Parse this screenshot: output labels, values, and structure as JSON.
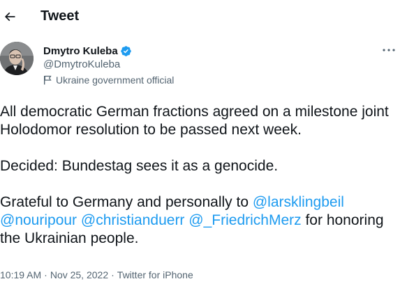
{
  "header": {
    "title": "Tweet",
    "back_icon": "arrow-left-icon"
  },
  "author": {
    "display_name": "Dmytro Kuleba",
    "handle": "@DmytroKuleba",
    "label": "Ukraine government official",
    "verified_icon": "verified-badge-icon",
    "label_icon": "flag-icon",
    "more_icon": "more-horizontal-icon"
  },
  "tweet": {
    "paragraph1": "All democratic German fractions agreed on a milestone joint Holodomor resolution to be passed next week.",
    "paragraph2": "Decided: Bundestag sees it as a genocide.",
    "paragraph3_prefix": "Grateful to Germany and personally to ",
    "mentions": [
      "@larsklingbeil",
      "@nouripour",
      "@christianduerr",
      "@_FriedrichMerz"
    ],
    "paragraph3_suffix": " for honoring the Ukrainian people."
  },
  "meta": {
    "time": "10:19 AM",
    "separator": "·",
    "date": "Nov 25, 2022",
    "source": "Twitter for iPhone"
  },
  "colors": {
    "text": "#0f1419",
    "secondary": "#536471",
    "link": "#1d9bf0",
    "verified": "#1d9bf0"
  }
}
